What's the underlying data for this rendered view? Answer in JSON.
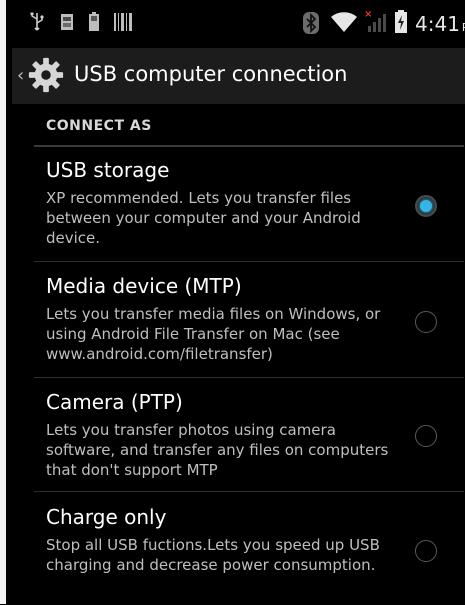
{
  "status_bar": {
    "time": "4:41",
    "ampm": "PM",
    "icons": [
      "usb-icon",
      "sdcard-icon",
      "battery-small-icon",
      "barcode-icon",
      "bluetooth-icon",
      "wifi-icon",
      "no-signal-icon",
      "battery-charging-icon"
    ]
  },
  "action_bar": {
    "title": "USB computer connection",
    "back_icon": "chevron-left-icon",
    "app_icon": "gear-icon"
  },
  "section": {
    "header": "CONNECT AS"
  },
  "options": [
    {
      "title": "USB storage",
      "description": "XP recommended. Lets you transfer files between your computer and your Android device.",
      "checked": true
    },
    {
      "title": "Media device (MTP)",
      "description": "Lets you transfer media files on Windows, or using Android File Transfer on Mac (see www.android.com/filetransfer)",
      "checked": false
    },
    {
      "title": "Camera (PTP)",
      "description": "Lets you transfer photos using camera software, and transfer any files on computers that don't support MTP",
      "checked": false
    },
    {
      "title": "Charge only",
      "description": "Stop all USB fuctions.Lets you speed up USB charging and decrease power consumption.",
      "checked": false
    }
  ],
  "colors": {
    "accent": "#33b5e5",
    "background": "#000000",
    "action_bar": "#1c1c1c"
  }
}
